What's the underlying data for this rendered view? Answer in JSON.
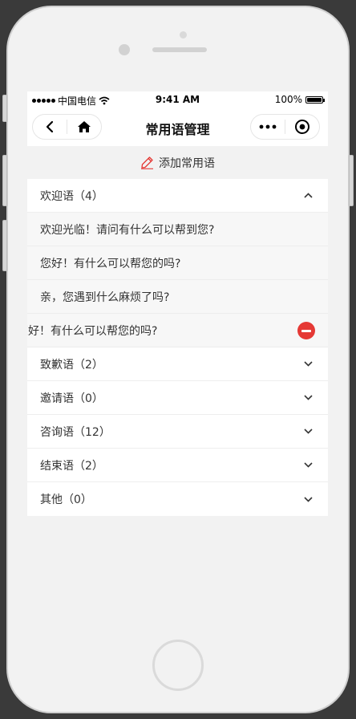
{
  "status_bar": {
    "carrier": "中国电信",
    "time": "9:41 AM",
    "battery": "100%"
  },
  "nav": {
    "title": "常用语管理"
  },
  "add": {
    "label": "添加常用语"
  },
  "groups": [
    {
      "title": "欢迎语（4）",
      "expanded": true,
      "phrases": [
        "欢迎光临！请问有什么可以帮到您?",
        "您好！有什么可以帮您的吗?",
        "亲，您遇到什么麻烦了吗?",
        "您好！有什么可以帮您的吗?"
      ]
    },
    {
      "title": "致歉语（2）"
    },
    {
      "title": "邀请语（0）"
    },
    {
      "title": "咨询语（12）"
    },
    {
      "title": "结束语（2）"
    },
    {
      "title": "其他（0）"
    }
  ],
  "colors": {
    "accent": "#e53935",
    "text": "#333333"
  }
}
